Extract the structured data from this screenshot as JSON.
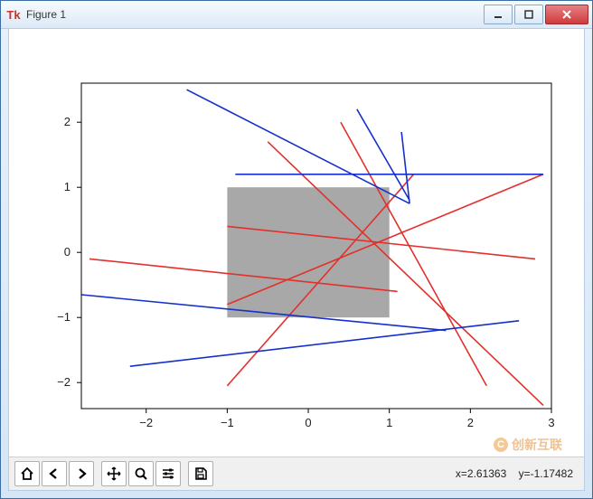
{
  "window": {
    "title": "Figure 1",
    "app_icon": "tk-icon"
  },
  "toolbar": {
    "buttons": {
      "home": "home-icon",
      "back": "arrow-left-icon",
      "forward": "arrow-right-icon",
      "pan": "move-icon",
      "zoom": "magnify-icon",
      "configure": "sliders-icon",
      "save": "save-icon"
    }
  },
  "status": {
    "coord_text": "x=2.61363    y=-1.17482"
  },
  "watermark": "创新互联",
  "chart_data": {
    "type": "line",
    "xlim": [
      -2.8,
      3.0
    ],
    "ylim": [
      -2.4,
      2.6
    ],
    "xticks": [
      -2,
      -1,
      0,
      1,
      2,
      3
    ],
    "yticks": [
      -2,
      -1,
      0,
      1,
      2
    ],
    "rect": {
      "x0": -1,
      "y0": -1,
      "x1": 1,
      "y1": 1,
      "color": "#9e9e9e"
    },
    "lines": [
      {
        "color": "red",
        "p1": [
          -2.7,
          -0.1
        ],
        "p2": [
          1.1,
          -0.6
        ]
      },
      {
        "color": "red",
        "p1": [
          -1.0,
          0.4
        ],
        "p2": [
          2.8,
          -0.1
        ]
      },
      {
        "color": "red",
        "p1": [
          -1.0,
          -0.8
        ],
        "p2": [
          2.9,
          1.2
        ]
      },
      {
        "color": "red",
        "p1": [
          -0.5,
          1.7
        ],
        "p2": [
          2.9,
          -2.35
        ]
      },
      {
        "color": "red",
        "p1": [
          0.4,
          2.0
        ],
        "p2": [
          2.2,
          -2.05
        ]
      },
      {
        "color": "red",
        "p1": [
          -1.0,
          -2.05
        ],
        "p2": [
          1.3,
          1.2
        ]
      },
      {
        "color": "blue",
        "p1": [
          -2.2,
          -1.75
        ],
        "p2": [
          2.6,
          -1.05
        ]
      },
      {
        "color": "blue",
        "p1": [
          -2.8,
          -0.65
        ],
        "p2": [
          1.7,
          -1.2
        ]
      },
      {
        "color": "blue",
        "p1": [
          -0.9,
          1.2
        ],
        "p2": [
          2.9,
          1.2
        ]
      },
      {
        "color": "blue",
        "p1": [
          -1.5,
          2.5
        ],
        "p2": [
          1.25,
          0.75
        ]
      },
      {
        "color": "blue",
        "p1": [
          0.6,
          2.2
        ],
        "p2": [
          1.25,
          0.8
        ]
      },
      {
        "color": "blue",
        "p1": [
          1.15,
          1.85
        ],
        "p2": [
          1.25,
          0.75
        ]
      }
    ]
  }
}
